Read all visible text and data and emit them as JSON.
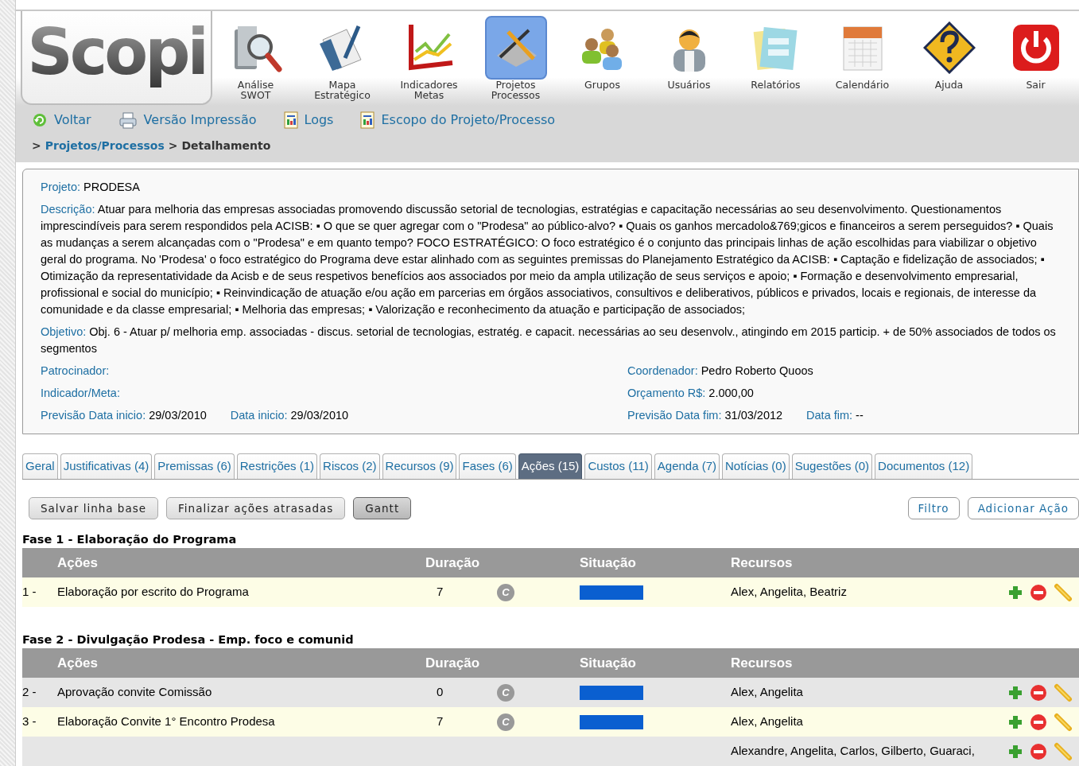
{
  "logo": "Scopi",
  "toolbar": [
    {
      "lines": [
        "Análise",
        "SWOT"
      ],
      "selected": false
    },
    {
      "lines": [
        "Mapa",
        "Estratégico"
      ],
      "selected": false
    },
    {
      "lines": [
        "Indicadores",
        "Metas"
      ],
      "selected": false
    },
    {
      "lines": [
        "Projetos",
        "Processos"
      ],
      "selected": true
    },
    {
      "lines": [
        "Grupos"
      ],
      "selected": false
    },
    {
      "lines": [
        "Usuários"
      ],
      "selected": false
    },
    {
      "lines": [
        "Relatórios"
      ],
      "selected": false
    },
    {
      "lines": [
        "Calendário"
      ],
      "selected": false
    },
    {
      "lines": [
        "Ajuda"
      ],
      "selected": false
    },
    {
      "lines": [
        "Sair"
      ],
      "selected": false
    }
  ],
  "nav_links": [
    "Voltar",
    "Versão Impressão",
    "Logs",
    "Escopo do Projeto/Processo"
  ],
  "breadcrumb": {
    "separator": ">",
    "link": "Projetos/Processos",
    "current": "Detalhamento"
  },
  "project": {
    "projeto": {
      "label": "Projeto:",
      "value": "PRODESA"
    },
    "descricao": {
      "label": "Descrição:",
      "value": "Atuar para melhoria das empresas associadas promovendo discussão setorial de tecnologias, estratégias e capacitação necessárias ao seu desenvolvimento. Questionamentos imprescindíveis para serem respondidos pela ACISB: ▪ O que se quer agregar com o \"Prodesa\" ao público-alvo? ▪ Quais os ganhos mercadolo&769;gicos e financeiros a serem perseguidos? ▪ Quais as mudanças a serem alcançadas com o \"Prodesa\" e em quanto tempo? FOCO ESTRATÉGICO: O foco estratégico é o conjunto das principais linhas de ação escolhidas para viabilizar o objetivo geral do programa. No 'Prodesa' o foco estratégico do Programa deve estar alinhado com as seguintes premissas do Planejamento Estratégico da ACISB: ▪ Captação e fidelização de associados; ▪ Otimização da representatividade da Acisb e de seus respetivos benefícios aos associados por meio da ampla utilização de seus serviços e apoio; ▪ Formação e desenvolvimento empresarial, profissional e social do município; ▪ Reinvindicação de atuação e/ou ação em parcerias em órgãos associativos, consultivos e deliberativos, públicos e privados, locais e regionais, de interesse da comunidade e da classe empresarial; ▪ Melhoria das empresas; ▪ Valorização e reconhecimento da atuação e participação de associados;"
    },
    "objetivo": {
      "label": "Objetivo:",
      "value": "Obj. 6 - Atuar p/ melhoria emp. associadas - discus. setorial de tecnologias, estratég. e capacit. necessárias ao seu desenvolv., atingindo em 2015 particip. + de 50% associados de todos os segmentos"
    },
    "left_fields": [
      {
        "label": "Patrocinador:"
      },
      {
        "label": "Indicador/Meta:"
      }
    ],
    "right_fields": [
      {
        "label": "Coordenador:",
        "value": "Pedro Roberto Quoos"
      },
      {
        "label": "Orçamento R$:",
        "value": "2.000,00"
      }
    ],
    "dates_left": [
      {
        "label": "Previsão Data inicio:",
        "value": "29/03/2010"
      },
      {
        "label": "Data inicio:",
        "value": "29/03/2010"
      }
    ],
    "dates_right": [
      {
        "label": "Previsão Data fim:",
        "value": "31/03/2012"
      },
      {
        "label": "Data fim:",
        "value": "--"
      }
    ]
  },
  "tabs": [
    {
      "label": "Geral",
      "selected": false
    },
    {
      "label": "Justificativas (4)",
      "selected": false
    },
    {
      "label": "Premissas (6)",
      "selected": false
    },
    {
      "label": "Restrições (1)",
      "selected": false
    },
    {
      "label": "Riscos (2)",
      "selected": false
    },
    {
      "label": "Recursos (9)",
      "selected": false
    },
    {
      "label": "Fases (6)",
      "selected": false
    },
    {
      "label": "Ações (15)",
      "selected": true
    },
    {
      "label": "Custos (11)",
      "selected": false
    },
    {
      "label": "Agenda (7)",
      "selected": false
    },
    {
      "label": "Notícias (0)",
      "selected": false
    },
    {
      "label": "Sugestões (0)",
      "selected": false
    },
    {
      "label": "Documentos (12)",
      "selected": false
    }
  ],
  "left_buttons": [
    {
      "label": "Salvar linha base",
      "pressed": false
    },
    {
      "label": "Finalizar ações atrasadas",
      "pressed": false
    },
    {
      "label": "Gantt",
      "pressed": true
    }
  ],
  "right_buttons": [
    "Filtro",
    "Adicionar Ação"
  ],
  "phases": [
    {
      "title": "Fase 1 - Elaboração do Programa",
      "columns": [
        "Ações",
        "Duração",
        "Situação",
        "Recursos"
      ],
      "rows": [
        {
          "number": "1 -",
          "action": "Elaboração por escrito do Programa",
          "duration": "7",
          "status_letter": "C",
          "color": "#0a5fd0",
          "resources": "Alex, Angelita, Beatriz"
        }
      ]
    },
    {
      "title": "Fase 2 - Divulgação Prodesa - Emp. foco e comunid",
      "columns": [
        "Ações",
        "Duração",
        "Situação",
        "Recursos"
      ],
      "rows": [
        {
          "number": "2 -",
          "action": "Aprovação convite Comissão",
          "duration": "0",
          "status_letter": "C",
          "color": "#0a5fd0",
          "resources": "Alex, Angelita"
        },
        {
          "number": "3 -",
          "action": "Elaboração Convite 1° Encontro Prodesa",
          "duration": "7",
          "status_letter": "C",
          "color": "#0a5fd0",
          "resources": "Alex, Angelita"
        },
        {
          "resources": "Alexandre, Angelita, Carlos, Gilberto, Guaraci,"
        }
      ]
    }
  ]
}
